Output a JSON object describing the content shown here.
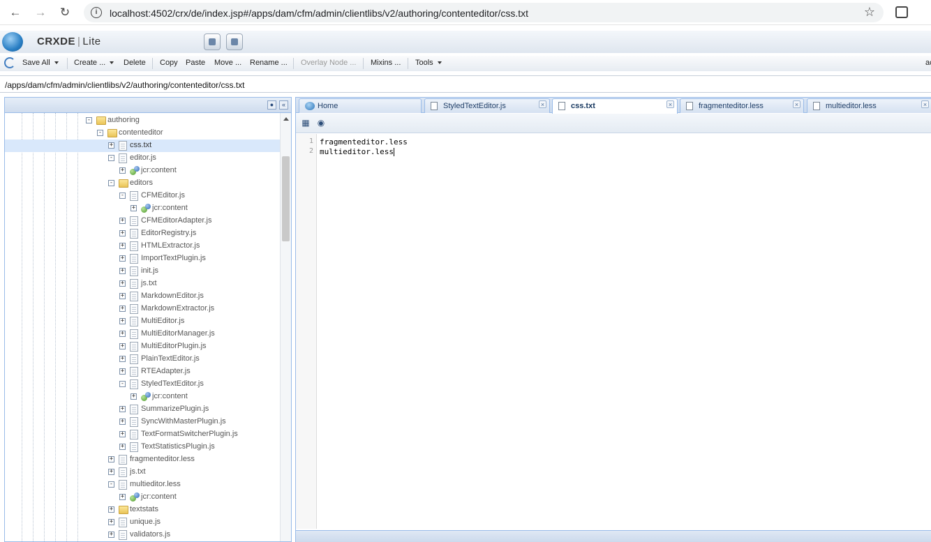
{
  "browser": {
    "url": "localhost:4502/crx/de/index.jsp#/apps/dam/cfm/admin/clientlibs/v2/authoring/contenteditor/css.txt"
  },
  "app": {
    "name_bold": "CRXDE",
    "name_light": "Lite"
  },
  "toolbar": {
    "save_all": "Save All",
    "create": "Create ...",
    "delete": "Delete",
    "copy": "Copy",
    "paste": "Paste",
    "move": "Move ...",
    "rename": "Rename ...",
    "overlay_node": "Overlay Node ...",
    "mixins": "Mixins ...",
    "tools": "Tools",
    "user_partial": "ac"
  },
  "path": "/apps/dam/cfm/admin/clientlibs/v2/authoring/contenteditor/css.txt",
  "tree": {
    "items": [
      {
        "label": "authoring",
        "type": "folder",
        "expander": "-"
      },
      {
        "label": "contenteditor",
        "type": "folder",
        "expander": "-"
      },
      {
        "label": "css.txt",
        "type": "file",
        "expander": "+",
        "selected": true
      },
      {
        "label": "editor.js",
        "type": "file",
        "expander": "-"
      },
      {
        "label": "jcr:content",
        "type": "node",
        "expander": "+"
      },
      {
        "label": "editors",
        "type": "folder",
        "expander": "-"
      },
      {
        "label": "CFMEditor.js",
        "type": "file",
        "expander": "-"
      },
      {
        "label": "jcr:content",
        "type": "node",
        "expander": "+"
      },
      {
        "label": "CFMEditorAdapter.js",
        "type": "file",
        "expander": "+"
      },
      {
        "label": "EditorRegistry.js",
        "type": "file",
        "expander": "+"
      },
      {
        "label": "HTMLExtractor.js",
        "type": "file",
        "expander": "+"
      },
      {
        "label": "ImportTextPlugin.js",
        "type": "file",
        "expander": "+"
      },
      {
        "label": "init.js",
        "type": "file",
        "expander": "+"
      },
      {
        "label": "js.txt",
        "type": "file",
        "expander": "+"
      },
      {
        "label": "MarkdownEditor.js",
        "type": "file",
        "expander": "+"
      },
      {
        "label": "MarkdownExtractor.js",
        "type": "file",
        "expander": "+"
      },
      {
        "label": "MultiEditor.js",
        "type": "file",
        "expander": "+"
      },
      {
        "label": "MultiEditorManager.js",
        "type": "file",
        "expander": "+"
      },
      {
        "label": "MultiEditorPlugin.js",
        "type": "file",
        "expander": "+"
      },
      {
        "label": "PlainTextEditor.js",
        "type": "file",
        "expander": "+"
      },
      {
        "label": "RTEAdapter.js",
        "type": "file",
        "expander": "+"
      },
      {
        "label": "StyledTextEditor.js",
        "type": "file",
        "expander": "-"
      },
      {
        "label": "jcr:content",
        "type": "node",
        "expander": "+"
      },
      {
        "label": "SummarizePlugin.js",
        "type": "file",
        "expander": "+"
      },
      {
        "label": "SyncWithMasterPlugin.js",
        "type": "file",
        "expander": "+"
      },
      {
        "label": "TextFormatSwitcherPlugin.js",
        "type": "file",
        "expander": "+"
      },
      {
        "label": "TextStatisticsPlugin.js",
        "type": "file",
        "expander": "+"
      },
      {
        "label": "fragmenteditor.less",
        "type": "file",
        "expander": "+"
      },
      {
        "label": "js.txt",
        "type": "file",
        "expander": "+"
      },
      {
        "label": "multieditor.less",
        "type": "file",
        "expander": "-"
      },
      {
        "label": "jcr:content",
        "type": "node",
        "expander": "+"
      },
      {
        "label": "textstats",
        "type": "folder",
        "expander": "+"
      },
      {
        "label": "unique.js",
        "type": "file",
        "expander": "+"
      },
      {
        "label": "validators.js",
        "type": "file",
        "expander": "+"
      }
    ]
  },
  "tabs": [
    {
      "label": "Home",
      "icon": "home-icon",
      "closable": false
    },
    {
      "label": "StyledTextEditor.js",
      "icon": "file-icon",
      "closable": true
    },
    {
      "label": "css.txt",
      "icon": "file-icon",
      "closable": true,
      "active": true
    },
    {
      "label": "fragmenteditor.less",
      "icon": "file-icon",
      "closable": true
    },
    {
      "label": "multieditor.less",
      "icon": "file-icon",
      "closable": true
    }
  ],
  "editor": {
    "lines": [
      {
        "num": "1",
        "text": "fragmenteditor.less"
      },
      {
        "num": "2",
        "text": "multieditor.less"
      }
    ]
  }
}
